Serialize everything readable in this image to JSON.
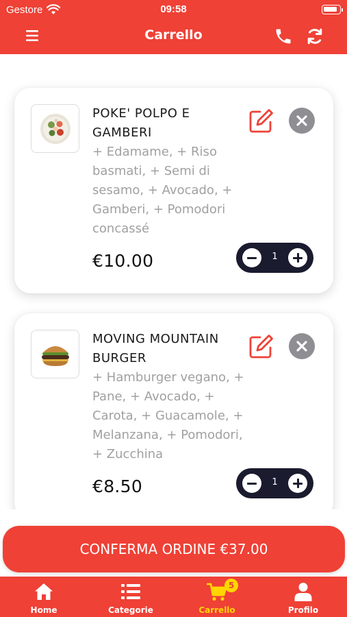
{
  "status_bar": {
    "carrier": "Gestore",
    "time": "09:58",
    "battery_level": 0.9
  },
  "header": {
    "title": "Carrello",
    "left_icon": "menu-icon",
    "right_icons": [
      "phone-icon",
      "refresh-icon"
    ],
    "color": "#ef4136"
  },
  "cart": {
    "items": [
      {
        "name": "POKE' POLPO E GAMBERI",
        "description": "+ Edamame, + Riso basmati, + Semi di sesamo, + Avocado, + Gamberi, + Pomodori concassé",
        "price": "€10.00",
        "quantity": "1",
        "thumb_icon": "poke-bowl-image"
      },
      {
        "name": "MOVING MOUNTAIN BURGER",
        "description": "+ Hamburger vegano, + Pane, + Avocado, + Carota, + Guacamole, + Melanzana, + Pomodori, + Zucchina",
        "price": "€8.50",
        "quantity": "1",
        "thumb_icon": "burger-image"
      }
    ]
  },
  "confirm_button": {
    "label": "CONFERMA ORDINE €37.00"
  },
  "bottom_nav": {
    "items": [
      {
        "label": "Home",
        "icon": "home-icon"
      },
      {
        "label": "Categorie",
        "icon": "list-icon"
      },
      {
        "label": "Carrello",
        "icon": "cart-icon",
        "badge": "5",
        "active": true
      },
      {
        "label": "Profilo",
        "icon": "user-icon"
      }
    ]
  },
  "colors": {
    "primary": "#ef4136",
    "active_nav": "#ffd600",
    "stepper_bg": "#1b1b2f",
    "remove_btn": "#8e8e93"
  }
}
